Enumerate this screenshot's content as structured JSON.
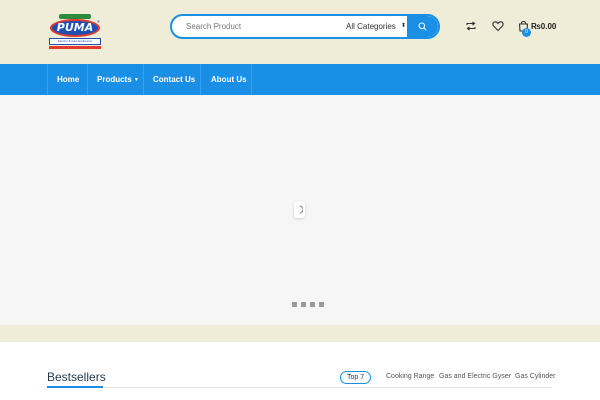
{
  "brand": {
    "logo_text": "PUMA",
    "logo_subtitle": "Electric & Gas Appliances"
  },
  "search": {
    "placeholder": "Search Product",
    "category": "All Categories"
  },
  "cart": {
    "count": "0",
    "total": "₨0.00"
  },
  "nav": {
    "items": [
      {
        "label": "Home"
      },
      {
        "label": "Products"
      },
      {
        "label": "Contact Us"
      },
      {
        "label": "About Us"
      }
    ]
  },
  "slider": {
    "dots_count": 4
  },
  "bestsellers": {
    "title": "Bestsellers",
    "tabs": [
      {
        "label": "Top 7"
      },
      {
        "label": "Cooking Range"
      },
      {
        "label": "Gas and Electric Gyser"
      },
      {
        "label": "Gas Cylinder"
      }
    ]
  },
  "colors": {
    "accent": "#1a8fe6",
    "header_bg": "#efecd7",
    "heading": "#1f3a52"
  },
  "icons": [
    "search-icon",
    "compare-icon",
    "heart-icon",
    "cart-icon",
    "chevron-down-icon",
    "loader-icon"
  ]
}
